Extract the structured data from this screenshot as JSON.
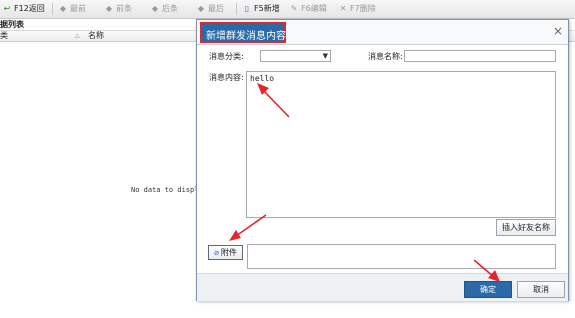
{
  "toolbar": {
    "items": [
      {
        "label": "F12返回",
        "icon": "return-icon",
        "enabled": true
      },
      {
        "label": "最前",
        "icon": "first-icon",
        "enabled": false
      },
      {
        "label": "前条",
        "icon": "prev-icon",
        "enabled": false
      },
      {
        "label": "后条",
        "icon": "next-icon",
        "enabled": false
      },
      {
        "label": "最后",
        "icon": "last-icon",
        "enabled": false
      },
      {
        "label": "F5新增",
        "icon": "new-doc-icon",
        "enabled": true
      },
      {
        "label": "F6编辑",
        "icon": "edit-icon",
        "enabled": false
      },
      {
        "label": "F7删除",
        "icon": "delete-icon",
        "enabled": false
      }
    ]
  },
  "list": {
    "title": "据列表",
    "columns": [
      "类",
      "名称"
    ],
    "empty_text": "No data to display"
  },
  "dialog": {
    "title": "新增群发消息内容",
    "close_glyph": "×",
    "category_label": "消息分类:",
    "category_value": "",
    "name_label": "消息名称:",
    "name_value": "",
    "content_label": "消息内容:",
    "content_value": "hello",
    "insert_friend_button": "插入好友名称",
    "attach_button": "附件",
    "ok_button": "确定",
    "cancel_button": "取消",
    "title_border_color": "#e8232a",
    "title_bg_color": "#2a6aa8",
    "annotation_color": "#e8232a"
  }
}
